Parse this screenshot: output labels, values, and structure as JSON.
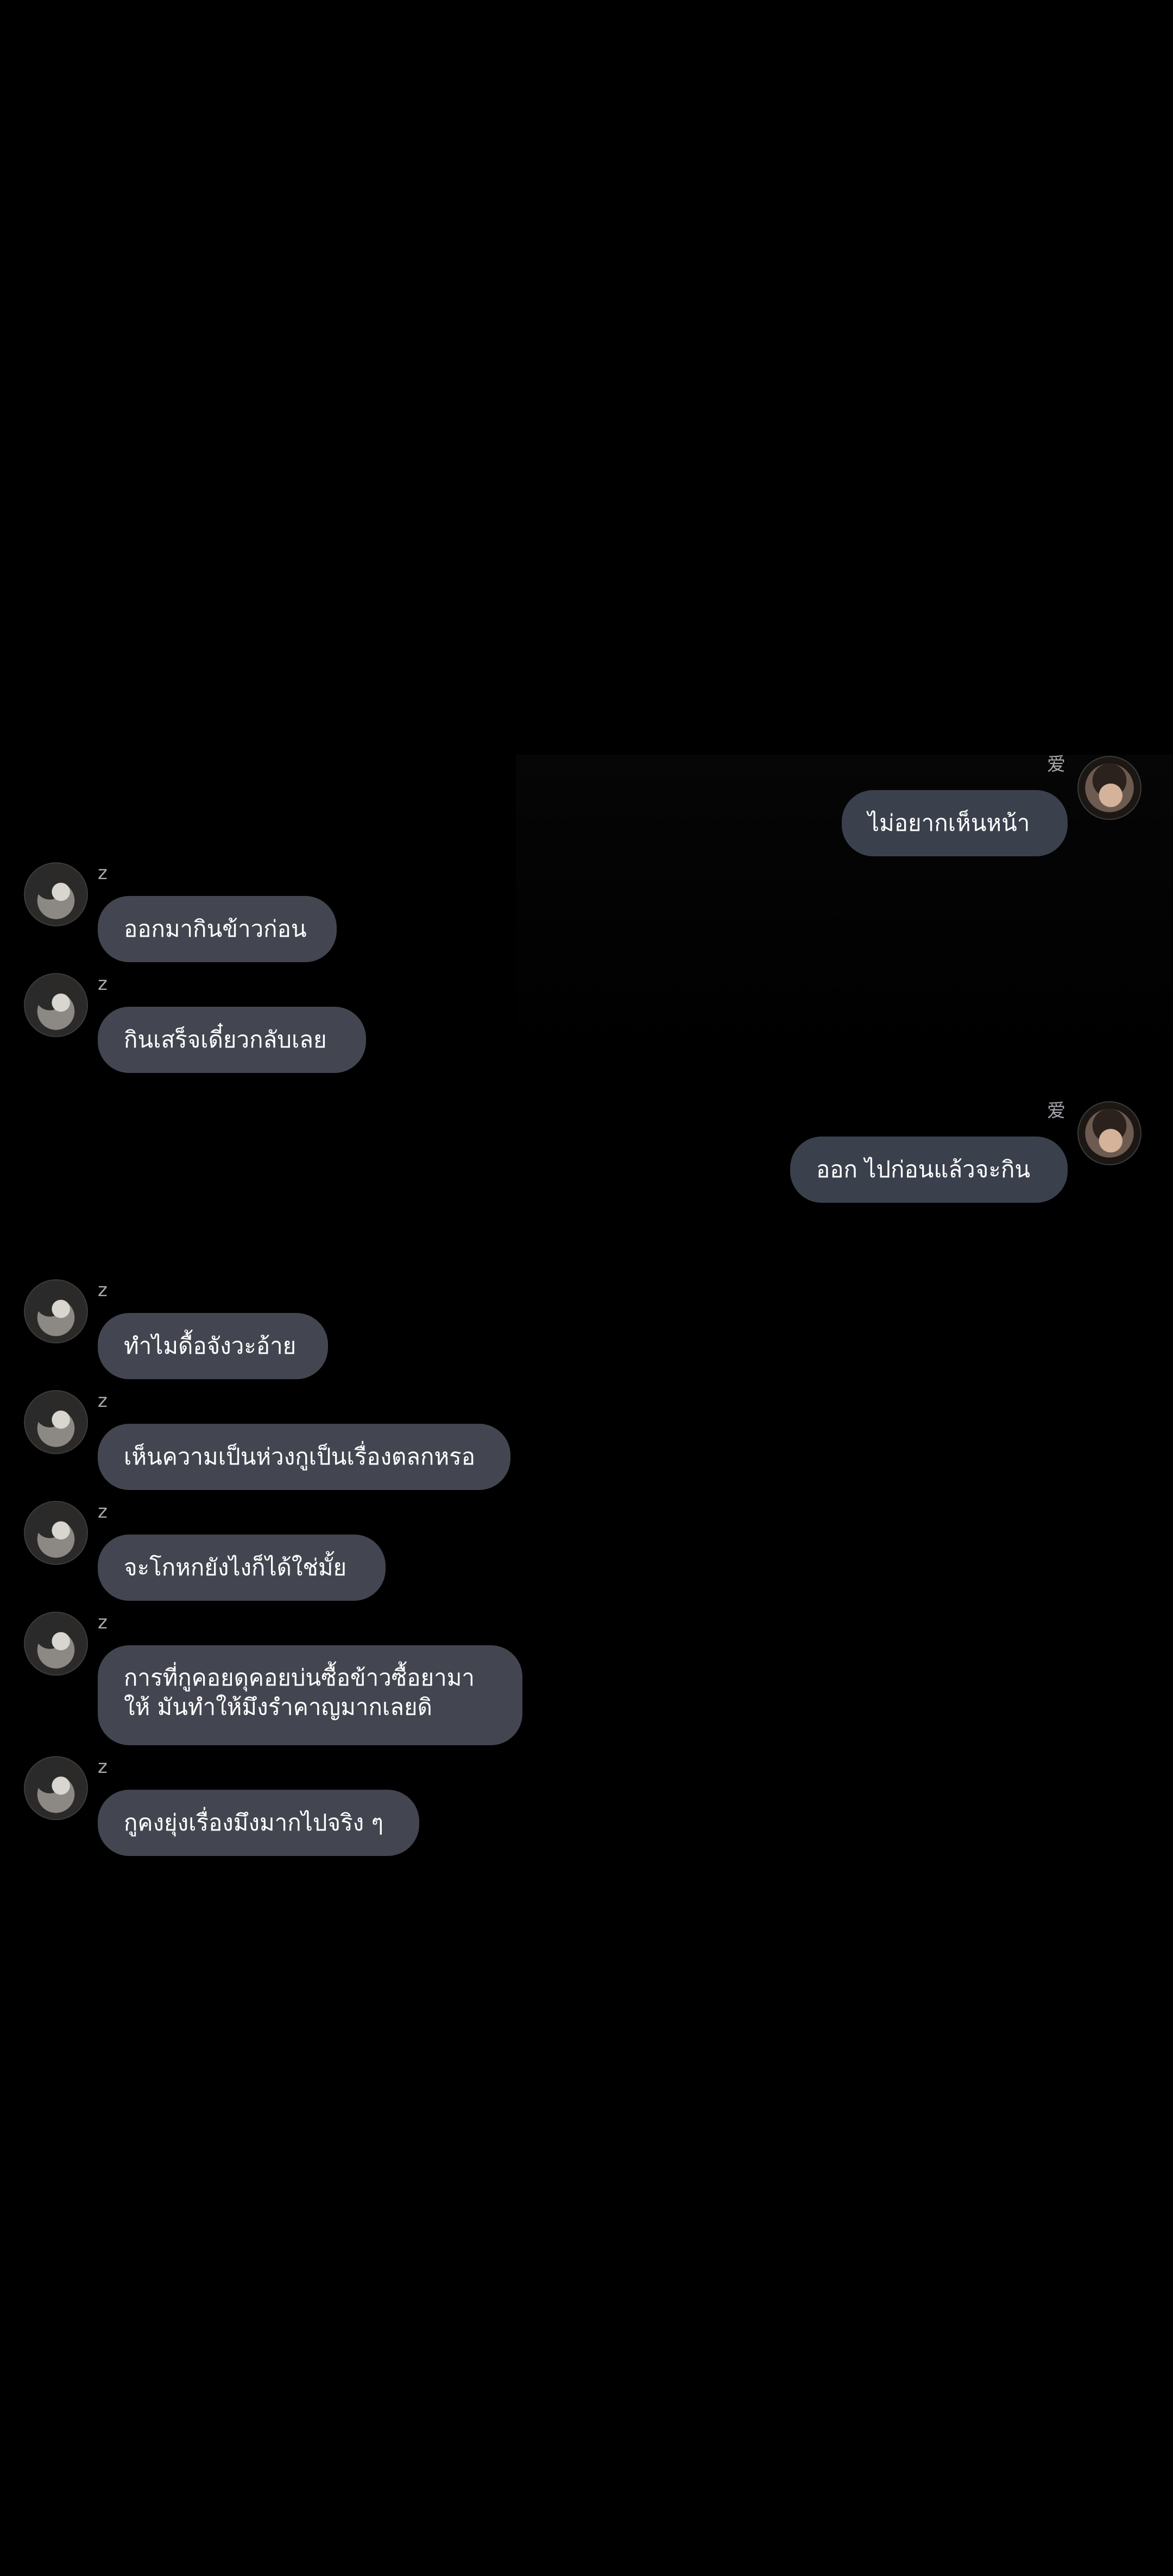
{
  "messages": [
    {
      "side": "right",
      "sender": "爱",
      "text": "ไม่อยากเห็นหน้า"
    },
    {
      "side": "left",
      "sender": "z",
      "text": "ออกมากินข้าวก่อน"
    },
    {
      "side": "left",
      "sender": "z",
      "text": "กินเสร็จเดี๋ยวกลับเลย"
    },
    {
      "side": "right",
      "sender": "爱",
      "text": "ออก ไปก่อนแล้วจะกิน"
    },
    {
      "side": "left",
      "sender": "z",
      "text": "ทำไมดื้อจังวะอ้าย"
    },
    {
      "side": "left",
      "sender": "z",
      "text": "เห็นความเป็นห่วงกูเป็นเรื่องตลกหรอ"
    },
    {
      "side": "left",
      "sender": "z",
      "text": "จะโกหกยังไงก็ได้ใช่มั้ย"
    },
    {
      "side": "left",
      "sender": "z",
      "lines": [
        "การที่กูคอยดุคอยบ่นซื้อข้าวซื้อยามา",
        "ให้ มันทำให้มึงรำคาญมากเลยดิ"
      ]
    },
    {
      "side": "left",
      "sender": "z",
      "text": "กูคงยุ่งเรื่องมึงมากไปจริง ๆ"
    }
  ],
  "avatars": {
    "left": "avatar-z",
    "right": "avatar-ai"
  },
  "colors": {
    "background": "#000000",
    "bubble_left": "#434650",
    "bubble_right": "#3b404d",
    "text": "#ffffff",
    "sender_name": "#a6a8ad"
  }
}
